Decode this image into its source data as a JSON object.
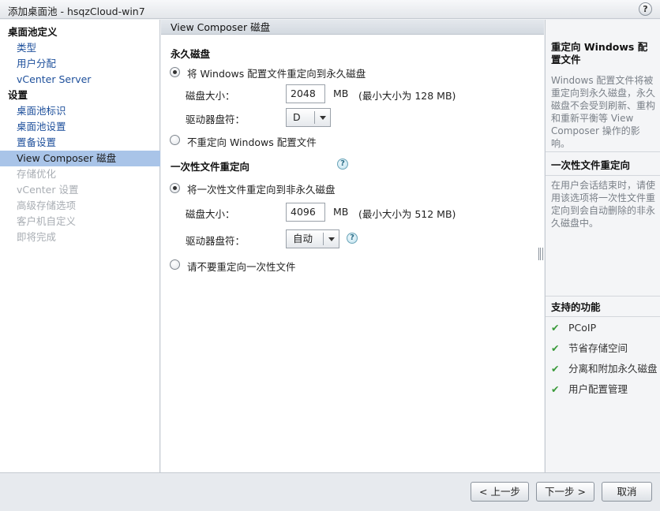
{
  "window": {
    "title": "添加桌面池 - hsqzCloud-win7",
    "help": "?"
  },
  "sidebar": {
    "items": [
      {
        "label": "桌面池定义",
        "kind": "head"
      },
      {
        "label": "类型",
        "kind": "link"
      },
      {
        "label": "用户分配",
        "kind": "link"
      },
      {
        "label": "vCenter Server",
        "kind": "link"
      },
      {
        "label": "设置",
        "kind": "head"
      },
      {
        "label": "桌面池标识",
        "kind": "link"
      },
      {
        "label": "桌面池设置",
        "kind": "link"
      },
      {
        "label": "置备设置",
        "kind": "link"
      },
      {
        "label": "View Composer 磁盘",
        "kind": "selected"
      },
      {
        "label": "存储优化",
        "kind": "disabled"
      },
      {
        "label": "vCenter 设置",
        "kind": "disabled"
      },
      {
        "label": "高级存储选项",
        "kind": "disabled"
      },
      {
        "label": "客户机自定义",
        "kind": "disabled"
      },
      {
        "label": "即将完成",
        "kind": "disabled"
      }
    ]
  },
  "main": {
    "header": "View Composer 磁盘",
    "persistent": {
      "title": "永久磁盘",
      "option_redirect": "将 Windows 配置文件重定向到永久磁盘",
      "disk_size_label": "磁盘大小：",
      "disk_size_value": "2048",
      "unit": "MB",
      "min_note": "(最小大小为 128 MB)",
      "drive_label": "驱动器盘符：",
      "drive_value": "D",
      "option_no_redirect": "不重定向 Windows 配置文件"
    },
    "disposable": {
      "title": "一次性文件重定向",
      "help": "?",
      "option_redirect": "将一次性文件重定向到非永久磁盘",
      "disk_size_label": "磁盘大小：",
      "disk_size_value": "4096",
      "unit": "MB",
      "min_note": "(最小大小为 512 MB)",
      "drive_label": "驱动器盘符：",
      "drive_value": "自动",
      "drive_help": "?",
      "option_no_redirect": "请不要重定向一次性文件"
    }
  },
  "right_panel": {
    "section1_title": "重定向 Windows 配置文件",
    "section1_text": "Windows 配置文件将被重定向到永久磁盘，永久磁盘不会受到刷新、重构和重新平衡等 View Composer 操作的影响。",
    "section2_title": "一次性文件重定向",
    "section2_text": "在用户会话结束时，请使用该选项将一次性文件重定向到会自动删除的非永久磁盘中。",
    "features_title": "支持的功能",
    "features": [
      {
        "check": "✔",
        "label": "PCoIP"
      },
      {
        "check": "✔",
        "label": "节省存储空间"
      },
      {
        "check": "✔",
        "label": "分离和附加永久磁盘"
      },
      {
        "check": "✔",
        "label": "用户配置管理"
      }
    ]
  },
  "footer": {
    "back": "< 上一步",
    "next": "下一步 >",
    "cancel": "取消"
  }
}
